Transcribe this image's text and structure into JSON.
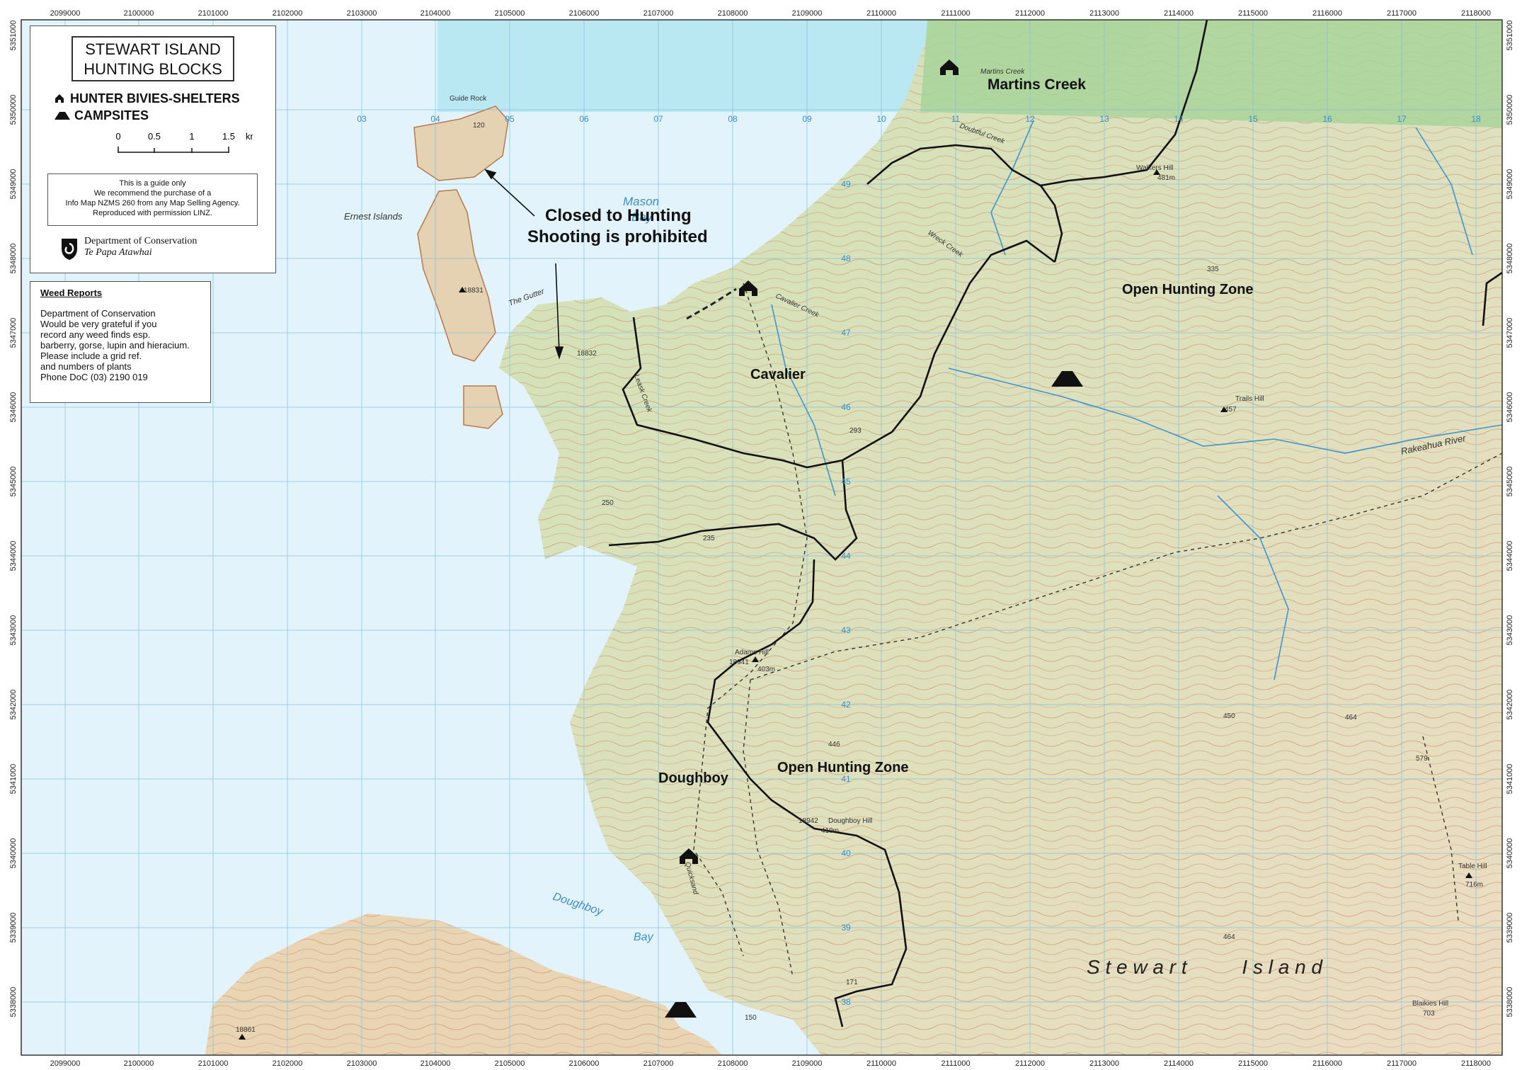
{
  "legend": {
    "title_line1": "STEWART ISLAND",
    "title_line2": "HUNTING BLOCKS",
    "bivies_label": "HUNTER BIVIES-SHELTERS",
    "campsites_label": "CAMPSITES",
    "scale_ticks": [
      "0",
      "0.5",
      "1",
      "1.5"
    ],
    "scale_unit": "km",
    "guide_lines": [
      "This is a guide only",
      "We recommend the purchase of a",
      "Info Map NZMS 260 from any Map Selling Agency.",
      "Reproduced with permission LINZ."
    ],
    "doc_name": "Department of Conservation",
    "doc_maori": "Te Papa Atawhai"
  },
  "weed_reports": {
    "title": "Weed Reports",
    "lines": [
      "Department of Conservation",
      "Would be very grateful if you",
      "record any weed finds esp.",
      "barberry, gorse, lupin and hieracium.",
      "Please include a grid ref.",
      "and numbers of plants",
      "Phone DoC (03) 2190 019"
    ]
  },
  "axes": {
    "x_labels": [
      "2099000",
      "2100000",
      "2101000",
      "2102000",
      "2103000",
      "2104000",
      "2105000",
      "2106000",
      "2107000",
      "2108000",
      "2109000",
      "2110000",
      "2111000",
      "2112000",
      "2113000",
      "2114000",
      "2115000",
      "2116000",
      "2117000",
      "2118000"
    ],
    "y_labels": [
      "5351000",
      "5350000",
      "5349000",
      "5348000",
      "5347000",
      "5346000",
      "5345000",
      "5344000",
      "5343000",
      "5342000",
      "5341000",
      "5340000",
      "5339000",
      "5338000"
    ]
  },
  "grid_numbers": {
    "top": [
      "03",
      "04",
      "05",
      "06",
      "07",
      "08",
      "09",
      "10",
      "11",
      "12",
      "13",
      "14",
      "15",
      "16",
      "17",
      "18"
    ],
    "side": [
      "49",
      "48",
      "47",
      "46",
      "45",
      "44",
      "43",
      "42",
      "41",
      "40",
      "39",
      "38"
    ]
  },
  "blocks": {
    "martins_creek": "Martins Creek",
    "open_zone_north": "Open Hunting Zone",
    "cavalier": "Cavalier",
    "doughboy": "Doughboy",
    "open_zone_south": "Open Hunting Zone"
  },
  "notice": {
    "line1": "Closed to Hunting",
    "line2": "Shooting is prohibited"
  },
  "water": {
    "mason_bay_1": "Mason",
    "mason_bay_2": "Bay",
    "doughboy_bay_1": "Doughboy",
    "doughboy_bay_2": "Bay"
  },
  "island_name": "S t e w a r t          I s l a n d",
  "features": {
    "guide_rock": "Guide Rock",
    "ernest_islands": "Ernest Islands",
    "the_gutter": "The Gutter",
    "martins_creek_small": "Martins Creek",
    "doubtful_creek": "Doubtful Creek",
    "walkers_hill": "Walkers Hill",
    "walkers_hill_height": "481m",
    "trails_hill": "Trails Hill",
    "trails_hill_height": "457",
    "rakeahua_river": "Rakeahua River",
    "adams_hill": "Adams Hill",
    "adams_hill_id": "18941",
    "adams_hill_height": "403m",
    "doughboy_hill": "Doughboy Hill",
    "doughboy_hill_id": "18942",
    "doughboy_hill_height": "410m",
    "table_hill": "Table Hill",
    "table_hill_height": "716m",
    "blaikies_hill": "Blaikies Hill",
    "blaikies_hill_height": "703",
    "trig_18832": "18832",
    "trig_18831": "18831",
    "trig_18861": "18861",
    "spot_335": "335",
    "spot_293": "293",
    "spot_250": "250",
    "spot_235": "235",
    "spot_446": "446",
    "spot_450": "450",
    "spot_464a": "464",
    "spot_464b": "464",
    "spot_579": "579",
    "spot_171": "171",
    "spot_150": "150",
    "spot_120": "120",
    "wreck_creek": "Wreck Creek",
    "cavalier_creek": "Cavalier Creek",
    "leask_creek": "Leask Creek",
    "quicksand": "Quicksand"
  },
  "colors": {
    "sea": "#dff2fb",
    "sea_shallow": "#b8e6f2",
    "land_green": "#c9deb0",
    "land_tan": "#eadfc2",
    "contour": "#c8875a",
    "boundary": "#111111",
    "water_text": "#3a8fc8"
  }
}
